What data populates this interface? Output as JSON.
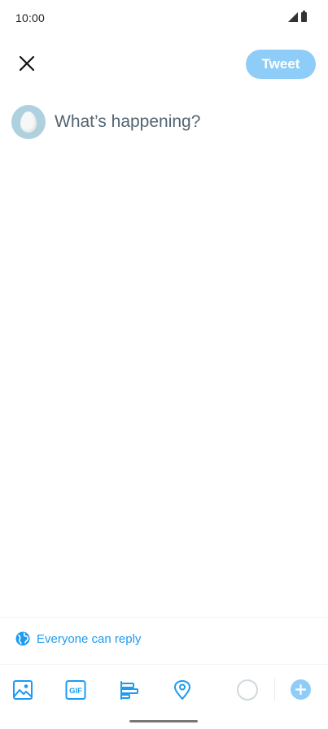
{
  "status_bar": {
    "time": "10:00"
  },
  "header": {
    "tweet_label": "Tweet"
  },
  "composer": {
    "placeholder": "What’s happening?"
  },
  "reply_setting": {
    "label": "Everyone can reply"
  },
  "toolbar": {
    "icons": [
      "image-icon",
      "gif-icon",
      "poll-icon",
      "location-icon",
      "char-counter",
      "add-thread-icon"
    ],
    "gif_glyph": "GIF"
  },
  "colors": {
    "accent": "#1d9bf0",
    "tweet_button_disabled": "#8ecdf8",
    "placeholder": "#536471",
    "avatar_bg": "#aed0df"
  }
}
